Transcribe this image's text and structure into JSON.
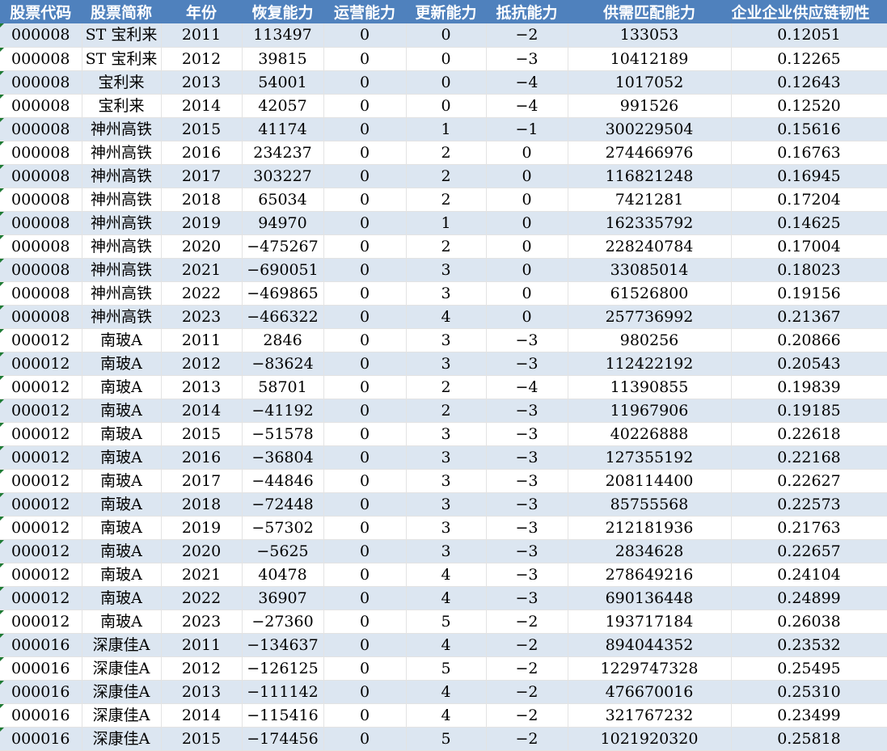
{
  "headers": [
    "股票代码",
    "股票简称",
    "年份",
    "恢复能力",
    "运营能力",
    "更新能力",
    "抵抗能力",
    "供需匹配能力",
    "企业企业供应链韧性"
  ],
  "rows": [
    [
      "000008",
      "ST 宝利来",
      "2011",
      "113497",
      "0",
      "0",
      "−2",
      "133053",
      "0.12051"
    ],
    [
      "000008",
      "ST 宝利来",
      "2012",
      "39815",
      "0",
      "0",
      "−3",
      "10412189",
      "0.12265"
    ],
    [
      "000008",
      "宝利来",
      "2013",
      "54001",
      "0",
      "0",
      "−4",
      "1017052",
      "0.12643"
    ],
    [
      "000008",
      "宝利来",
      "2014",
      "42057",
      "0",
      "0",
      "−4",
      "991526",
      "0.12520"
    ],
    [
      "000008",
      "神州高铁",
      "2015",
      "41174",
      "0",
      "1",
      "−1",
      "300229504",
      "0.15616"
    ],
    [
      "000008",
      "神州高铁",
      "2016",
      "234237",
      "0",
      "2",
      "0",
      "274466976",
      "0.16763"
    ],
    [
      "000008",
      "神州高铁",
      "2017",
      "303227",
      "0",
      "2",
      "0",
      "116821248",
      "0.16945"
    ],
    [
      "000008",
      "神州高铁",
      "2018",
      "65034",
      "0",
      "2",
      "0",
      "7421281",
      "0.17204"
    ],
    [
      "000008",
      "神州高铁",
      "2019",
      "94970",
      "0",
      "1",
      "0",
      "162335792",
      "0.14625"
    ],
    [
      "000008",
      "神州高铁",
      "2020",
      "−475267",
      "0",
      "2",
      "0",
      "228240784",
      "0.17004"
    ],
    [
      "000008",
      "神州高铁",
      "2021",
      "−690051",
      "0",
      "3",
      "0",
      "33085014",
      "0.18023"
    ],
    [
      "000008",
      "神州高铁",
      "2022",
      "−469865",
      "0",
      "3",
      "0",
      "61526800",
      "0.19156"
    ],
    [
      "000008",
      "神州高铁",
      "2023",
      "−466322",
      "0",
      "4",
      "0",
      "257736992",
      "0.21367"
    ],
    [
      "000012",
      "南玻A",
      "2011",
      "2846",
      "0",
      "3",
      "−3",
      "980256",
      "0.20866"
    ],
    [
      "000012",
      "南玻A",
      "2012",
      "−83624",
      "0",
      "3",
      "−3",
      "112422192",
      "0.20543"
    ],
    [
      "000012",
      "南玻A",
      "2013",
      "58701",
      "0",
      "2",
      "−4",
      "11390855",
      "0.19839"
    ],
    [
      "000012",
      "南玻A",
      "2014",
      "−41192",
      "0",
      "2",
      "−3",
      "11967906",
      "0.19185"
    ],
    [
      "000012",
      "南玻A",
      "2015",
      "−51578",
      "0",
      "3",
      "−3",
      "40226888",
      "0.22618"
    ],
    [
      "000012",
      "南玻A",
      "2016",
      "−36804",
      "0",
      "3",
      "−3",
      "127355192",
      "0.22168"
    ],
    [
      "000012",
      "南玻A",
      "2017",
      "−44846",
      "0",
      "3",
      "−3",
      "208114400",
      "0.22627"
    ],
    [
      "000012",
      "南玻A",
      "2018",
      "−72448",
      "0",
      "3",
      "−3",
      "85755568",
      "0.22573"
    ],
    [
      "000012",
      "南玻A",
      "2019",
      "−57302",
      "0",
      "3",
      "−3",
      "212181936",
      "0.21763"
    ],
    [
      "000012",
      "南玻A",
      "2020",
      "−5625",
      "0",
      "3",
      "−3",
      "2834628",
      "0.22657"
    ],
    [
      "000012",
      "南玻A",
      "2021",
      "40478",
      "0",
      "4",
      "−3",
      "278649216",
      "0.24104"
    ],
    [
      "000012",
      "南玻A",
      "2022",
      "36907",
      "0",
      "4",
      "−3",
      "690136448",
      "0.24899"
    ],
    [
      "000012",
      "南玻A",
      "2023",
      "−27360",
      "0",
      "5",
      "−2",
      "193717184",
      "0.26038"
    ],
    [
      "000016",
      "深康佳A",
      "2011",
      "−134637",
      "0",
      "4",
      "−2",
      "894044352",
      "0.23532"
    ],
    [
      "000016",
      "深康佳A",
      "2012",
      "−126125",
      "0",
      "5",
      "−2",
      "1229747328",
      "0.25495"
    ],
    [
      "000016",
      "深康佳A",
      "2013",
      "−111142",
      "0",
      "4",
      "−2",
      "476670016",
      "0.25310"
    ],
    [
      "000016",
      "深康佳A",
      "2014",
      "−115416",
      "0",
      "4",
      "−2",
      "321767232",
      "0.23499"
    ],
    [
      "000016",
      "深康佳A",
      "2015",
      "−174456",
      "0",
      "5",
      "−2",
      "1021920320",
      "0.25818"
    ]
  ],
  "colors": {
    "header_bg": "#4f81bd",
    "header_text": "#ffffff",
    "band_row": "#dce6f1",
    "plain_row": "#ffffff",
    "error_marker": "#1e7b34"
  }
}
